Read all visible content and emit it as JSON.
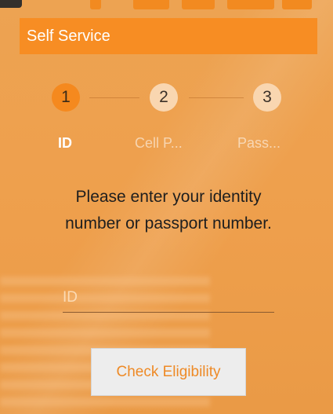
{
  "app": {
    "title": "Self Service"
  },
  "stepper": {
    "steps": [
      {
        "number": "1",
        "label": "ID",
        "state": "active"
      },
      {
        "number": "2",
        "label": "Cell P...",
        "state": "pending"
      },
      {
        "number": "3",
        "label": "Pass...",
        "state": "pending"
      }
    ]
  },
  "form": {
    "prompt_line1": "Please enter your identity",
    "prompt_line2": "number or passport number.",
    "id_placeholder": "ID",
    "id_value": "",
    "submit_label": "Check Eligibility"
  },
  "colors": {
    "brand_orange": "#F78D23",
    "background": "#ECA04F",
    "button_bg": "#EDEDED",
    "button_text": "#EE8A26"
  }
}
